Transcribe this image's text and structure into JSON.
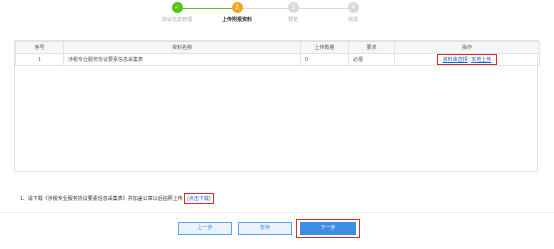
{
  "steps": [
    {
      "num": "✓",
      "label": "协议信息管理",
      "state": "done"
    },
    {
      "num": "2",
      "label": "上传附报资料",
      "state": "active"
    },
    {
      "num": "3",
      "label": "预览",
      "state": "pending"
    },
    {
      "num": "4",
      "label": "完成",
      "state": "pending"
    }
  ],
  "table": {
    "headers": [
      "序号",
      "资料名称",
      "上传数量",
      "要求",
      "操作"
    ],
    "rows": [
      {
        "index": "1",
        "name": "涉税专业服务协议要素信息采集表",
        "count": "0",
        "requirement": "必报",
        "action_select": "资料库选择",
        "action_upload": "本地上传"
      }
    ]
  },
  "note": {
    "text": "1、请下载《涉税专业服务协议要素信息采集表》并加盖公章以后拍照上传",
    "download_link": "(点击下载)"
  },
  "buttons": {
    "prev": "上一步",
    "save": "暂存",
    "next": "下一步"
  },
  "colors": {
    "done": "#52c41a",
    "active": "#f5a623",
    "pending": "#d9d9d9",
    "primary": "#3d8de0",
    "highlight_border": "#d32b2b"
  }
}
